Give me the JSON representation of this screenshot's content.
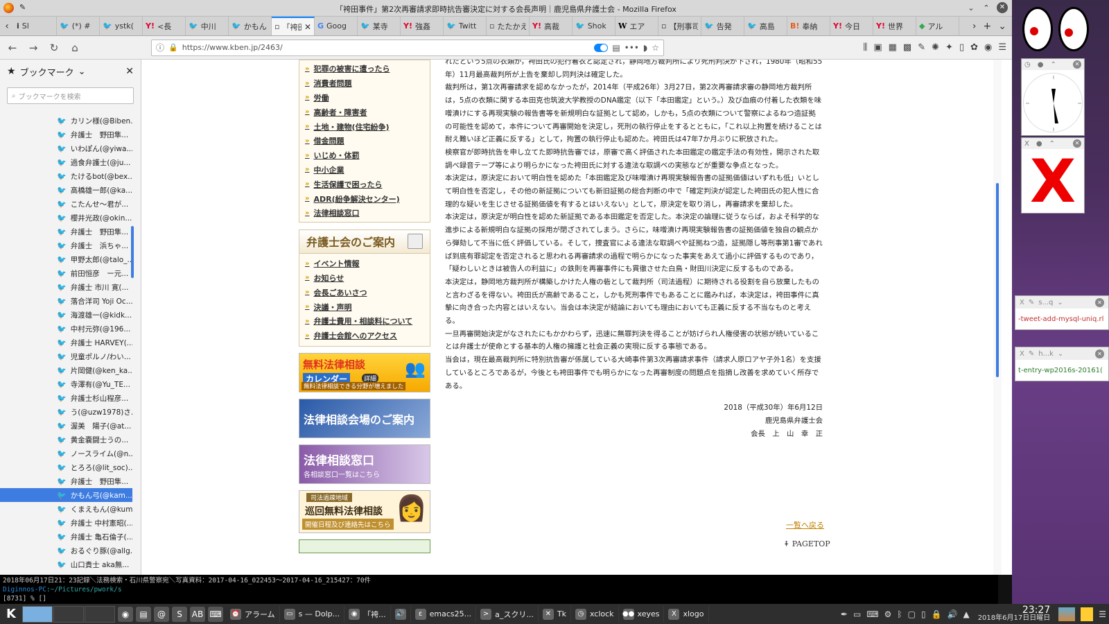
{
  "window": {
    "title": "「袴田事件」第2次再審請求即時抗告審決定に対する会長声明｜鹿児島県弁護士会 - Mozilla Firefox"
  },
  "tabs": [
    {
      "icon": "i",
      "label": "Sl"
    },
    {
      "icon": "twitter",
      "label": "(*) #"
    },
    {
      "icon": "twitter",
      "label": "ystk("
    },
    {
      "icon": "yahoo",
      "label": "<長"
    },
    {
      "icon": "twitter",
      "label": "中川"
    },
    {
      "icon": "twitter",
      "label": "かもん"
    },
    {
      "icon": "doc",
      "label": "「袴田",
      "active": true
    },
    {
      "icon": "google",
      "label": "Goog"
    },
    {
      "icon": "twitter",
      "label": "某寺"
    },
    {
      "icon": "yahoo",
      "label": "強姦"
    },
    {
      "icon": "twitter",
      "label": "Twitt"
    },
    {
      "icon": "doc",
      "label": "たたかえ"
    },
    {
      "icon": "yahoo",
      "label": "高裁"
    },
    {
      "icon": "twitter",
      "label": "Shok"
    },
    {
      "icon": "wiki",
      "label": "エア"
    },
    {
      "icon": "doc",
      "label": "【刑事司"
    },
    {
      "icon": "twitter",
      "label": "告発"
    },
    {
      "icon": "twitter",
      "label": "高島"
    },
    {
      "icon": "hatena",
      "label": "奉納"
    },
    {
      "icon": "yahoo",
      "label": "今日"
    },
    {
      "icon": "yahoo",
      "label": "世界"
    },
    {
      "icon": "chrome",
      "label": "アル"
    }
  ],
  "navbar": {
    "url": "https://www.kben.jp/2463/"
  },
  "sidebar": {
    "title": "ブックマーク",
    "search_placeholder": "ブックマークを検索",
    "items": [
      "カリン様(@Biben...",
      "弁護士　野田隼...",
      "いわぽん(@yiwa...",
      "過食弁護士(@ju...",
      "たけるbot(@bex...",
      "高橋雄一郎(@ka...",
      "こたんせ～君が...",
      "櫻井光政(@okin...",
      "弁護士　野田隼...",
      "弁護士　浜ちゃ...",
      "甲野太郎(@talo_...",
      "前田恒彦　ー元...",
      "弁護士 市川 寛(...",
      "落合洋司 Yoji Oc...",
      "海渡雄一(@kidk...",
      "中村元弥(@196...",
      "弁護士 HARVEY(...",
      "児童ポルノ/わい...",
      "片岡健(@ken_ka...",
      "寺澤有(@Yu_TE...",
      "弁護士杉山程彦...",
      "う(@uzw1978)さ...",
      "渥美　陽子(@at...",
      "黄金嚢闘士うの...",
      "ノースライム(@n...",
      "とろろ(@lit_soc)...",
      "弁護士　野田隼...",
      "かもん弓(@kam...",
      "くまえもん(@kum...",
      "弁護士 中村憲昭(...",
      "弁護士 亀石倫子(...",
      "おるぐり豚(@allg...",
      "山口貴士 aka無..."
    ],
    "selected_index": 27
  },
  "page": {
    "menu_items": [
      "犯罪の被害に遭ったら",
      "消費者問題",
      "労働",
      "高齢者・障害者",
      "土地・建物(住宅紛争)",
      "借金問題",
      "いじめ・体罰",
      "中小企業",
      "生活保護で困ったら",
      "ADR(紛争解決センター)",
      "法律相談窓口"
    ],
    "box2_title": "弁護士会のご案内",
    "box2_items": [
      "イベント情報",
      "お知らせ",
      "会長ごあいさつ",
      "決議・声明",
      "弁護士費用・相談料について",
      "弁護士会館へのアクセス"
    ],
    "banner1": {
      "title": "無料法律相談",
      "sub": "カレンダー",
      "detail": "詳細",
      "note": "無料法律相談できる分野が増えました"
    },
    "banner2": {
      "title": "法律相談会場のご案内"
    },
    "banner3": {
      "title": "法律相談窓口",
      "sub": "各相談窓口一覧はこちら"
    },
    "banner4": {
      "tag": "司法過疎地域",
      "title": "巡回無料法律相談",
      "sub": "開催日程及び連絡先はこちら"
    },
    "article": [
      "れたという5点の衣類が，袴田氏の犯行着衣と認定され，静岡地方裁判所により死刑判決が下され，1980年（昭和55年）11月最高裁判所が上告を棄却し同判決は確定した。",
      "裁判所は，第1次再審請求を認めなかったが，2014年（平成26年）3月27日，第2次再審請求審の静岡地方裁判所は，5点の衣類に関する本田克也筑波大学教授のDNA鑑定（以下「本田鑑定」という。）及び血痕の付着した衣類を味噌漬けにする再現実験の報告書等を新規明白な証拠として認め，しかも，5点の衣類について警察によるねつ造証拠の可能性を認めて，本件について再審開始を決定し，死刑の執行停止をするとともに，「これ以上拘置を続けることは耐え難いほど正義に反する」として，拘置の執行停止も認めた。袴田氏は47年7か月ぶりに釈放された。",
      "検察官が即時抗告を申し立てた即時抗告審では，原審で高く評価された本田鑑定の鑑定手法の有効性，開示された取調べ録音テープ等により明らかになった袴田氏に対する違法な取調べの実態などが重要な争点となった。",
      "本決定は，原決定において明白性を認めた「本田鑑定及び味噌漬け再現実験報告書の証拠価値はいずれも低」いとして明白性を否定し，その他の新証拠についても新旧証拠の総合判断の中で「確定判決が認定した袴田氏の犯人性に合理的な疑いを生じさせる証拠価値を有するとはいえない」として，原決定を取り消し，再審請求を棄却した。",
      "本決定は，原決定が明白性を認めた新証拠である本田鑑定を否定した。本決定の論理に従うならば，およそ科学的な進歩による新規明白な証拠の採用が閉ざされてしまう。さらに，味噌漬け再現実験報告書の証拠価値を独自の観点から弾劾して不当に低く評価している。そして，捜査官による違法な取調べや証拠ねつ造，証拠隠し等刑事第1審であれば到底有罪認定を否定されると思われる再審請求の過程で明らかになった事実をあえて過小に評価するものであり，「疑わしいときは被告人の利益に」の鉄則を再審事件にも貫徹させた白鳥・財田川決定に反するものである。",
      "本決定は，静岡地方裁判所が構築しかけた人権の砦として裁判所（司法過程）に期待される役割を自ら放棄したものと言わざるを得ない。袴田氏が高齢であること，しかも死刑事件でもあることに鑑みれば，本決定は，袴田事件に真摯に向き合った内容とはいえない。当会は本決定が結論においても理由においても正義に反する不当なものと考える。",
      "一旦再審開始決定がなされたにもかかわらず，迅速に無罪判決を得ることが妨げられ人権侵害の状態が続いていることは弁護士が使命とする基本的人権の擁護と社会正義の実現に反する事態である。",
      "当会は，現在最高裁判所に特別抗告審が係属している大崎事件第3次再審請求事件（請求人原口アヤ子外1名）を支援しているところであるが，今後とも袴田事件でも明らかになった再審制度の問題点を指摘し改善を求めていく所存である。"
    ],
    "date": "2018（平成30年）年6月12日",
    "org": "鹿児島県弁護士会",
    "signer": "会長　上　山　幸　正",
    "back_link": "一覧へ戻る",
    "pagetop": "PAGETOP"
  },
  "terminal": {
    "line1": "2018年06月17日21：23記録＼法務検索・石川県警察宛＼写真資料：2017-04-16_022453〜2017-04-16_215427：70件",
    "prompt_host": "Diginnos-PC",
    "prompt_path": ":~/Pictures/pwork/s",
    "line3": "[8731]  % []"
  },
  "right_panel": {
    "clip1": "-tweet-add-mysql-uniq.rl",
    "clip1_title": "s...q",
    "clip2": "t-entry-wp2016s-20161(",
    "clip2_title": "h...k"
  },
  "taskbar": {
    "tasks": [
      {
        "icon": "alarm",
        "label": "アラーム"
      },
      {
        "icon": "folder",
        "label": "s — Dolp..."
      },
      {
        "icon": "firefox",
        "label": "「袴..."
      },
      {
        "icon": "speaker",
        "label": ""
      },
      {
        "icon": "emacs",
        "label": "emacs25..."
      },
      {
        "icon": "terminal",
        "label": "a_スクリ..."
      },
      {
        "icon": "tk",
        "label": "Tk"
      },
      {
        "icon": "clock",
        "label": "xclock"
      },
      {
        "icon": "eyes",
        "label": "xeyes"
      },
      {
        "icon": "x",
        "label": "xlogo"
      }
    ],
    "time": "23:27",
    "date": "2018年6月17日日曜日"
  }
}
